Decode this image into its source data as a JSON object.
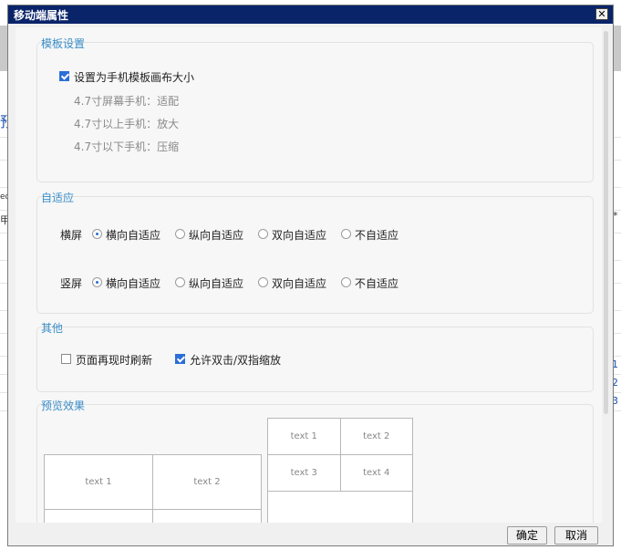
{
  "dialog": {
    "title": "移动端属性",
    "close_glyph": "✕",
    "ok_label": "确定",
    "cancel_label": "取消"
  },
  "template": {
    "legend": "模板设置",
    "checkbox_label": "设置为手机模板画布大小",
    "checkbox_checked": true,
    "hints": [
      "4.7寸屏幕手机：适配",
      "4.7寸以上手机：放大",
      "4.7寸以下手机：压缩"
    ]
  },
  "adaptive": {
    "legend": "自适应",
    "rows": [
      {
        "label": "横屏",
        "options": [
          "横向自适应",
          "纵向自适应",
          "双向自适应",
          "不自适应"
        ],
        "selected": 0
      },
      {
        "label": "竖屏",
        "options": [
          "横向自适应",
          "纵向自适应",
          "双向自适应",
          "不自适应"
        ],
        "selected": 0
      }
    ]
  },
  "other": {
    "legend": "其他",
    "refresh_label": "页面再现时刷新",
    "refresh_checked": false,
    "zoom_label": "允许双击/双指缩放",
    "zoom_checked": true
  },
  "preview": {
    "legend": "预览效果",
    "landscape_cells": [
      "text 1",
      "text 2"
    ],
    "portrait_cells": [
      "text 1",
      "text 2",
      "text 3",
      "text 4"
    ]
  },
  "background": {
    "fragments": [
      "预",
      "ed",
      "甲",
      "1",
      "2",
      "3",
      "*"
    ]
  }
}
